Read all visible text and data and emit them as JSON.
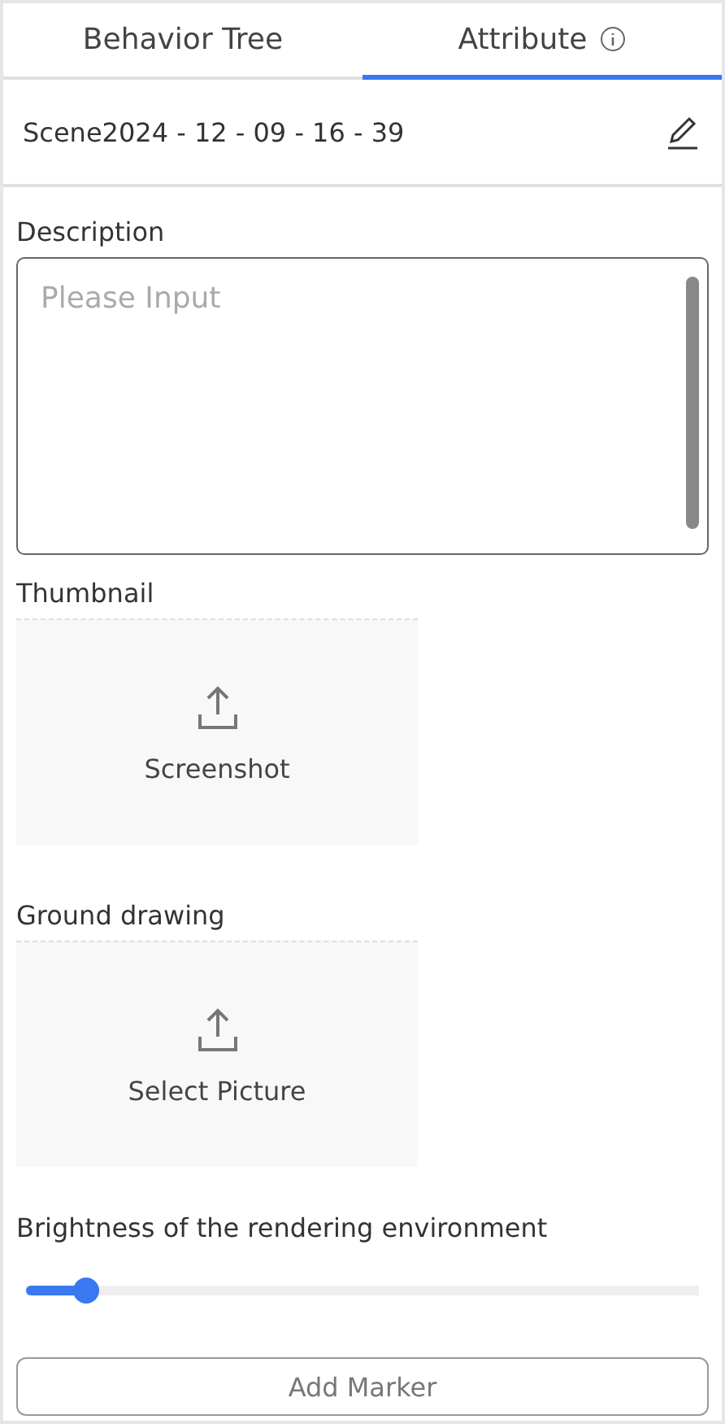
{
  "tabs": [
    {
      "label": "Behavior Tree",
      "selected": false,
      "info": false
    },
    {
      "label": "Attribute",
      "selected": true,
      "info": true
    }
  ],
  "scene": {
    "name": "Scene2024 - 12 - 09 - 16 - 39"
  },
  "description": {
    "label": "Description",
    "placeholder": "Please Input"
  },
  "uploads": [
    {
      "label": "Thumbnail",
      "action": "Screenshot"
    },
    {
      "label": "Ground drawing",
      "action": "Select Picture"
    }
  ],
  "brightness": {
    "label": "Brightness of the rendering environment",
    "level": 0.09
  },
  "button": "Add Marker"
}
